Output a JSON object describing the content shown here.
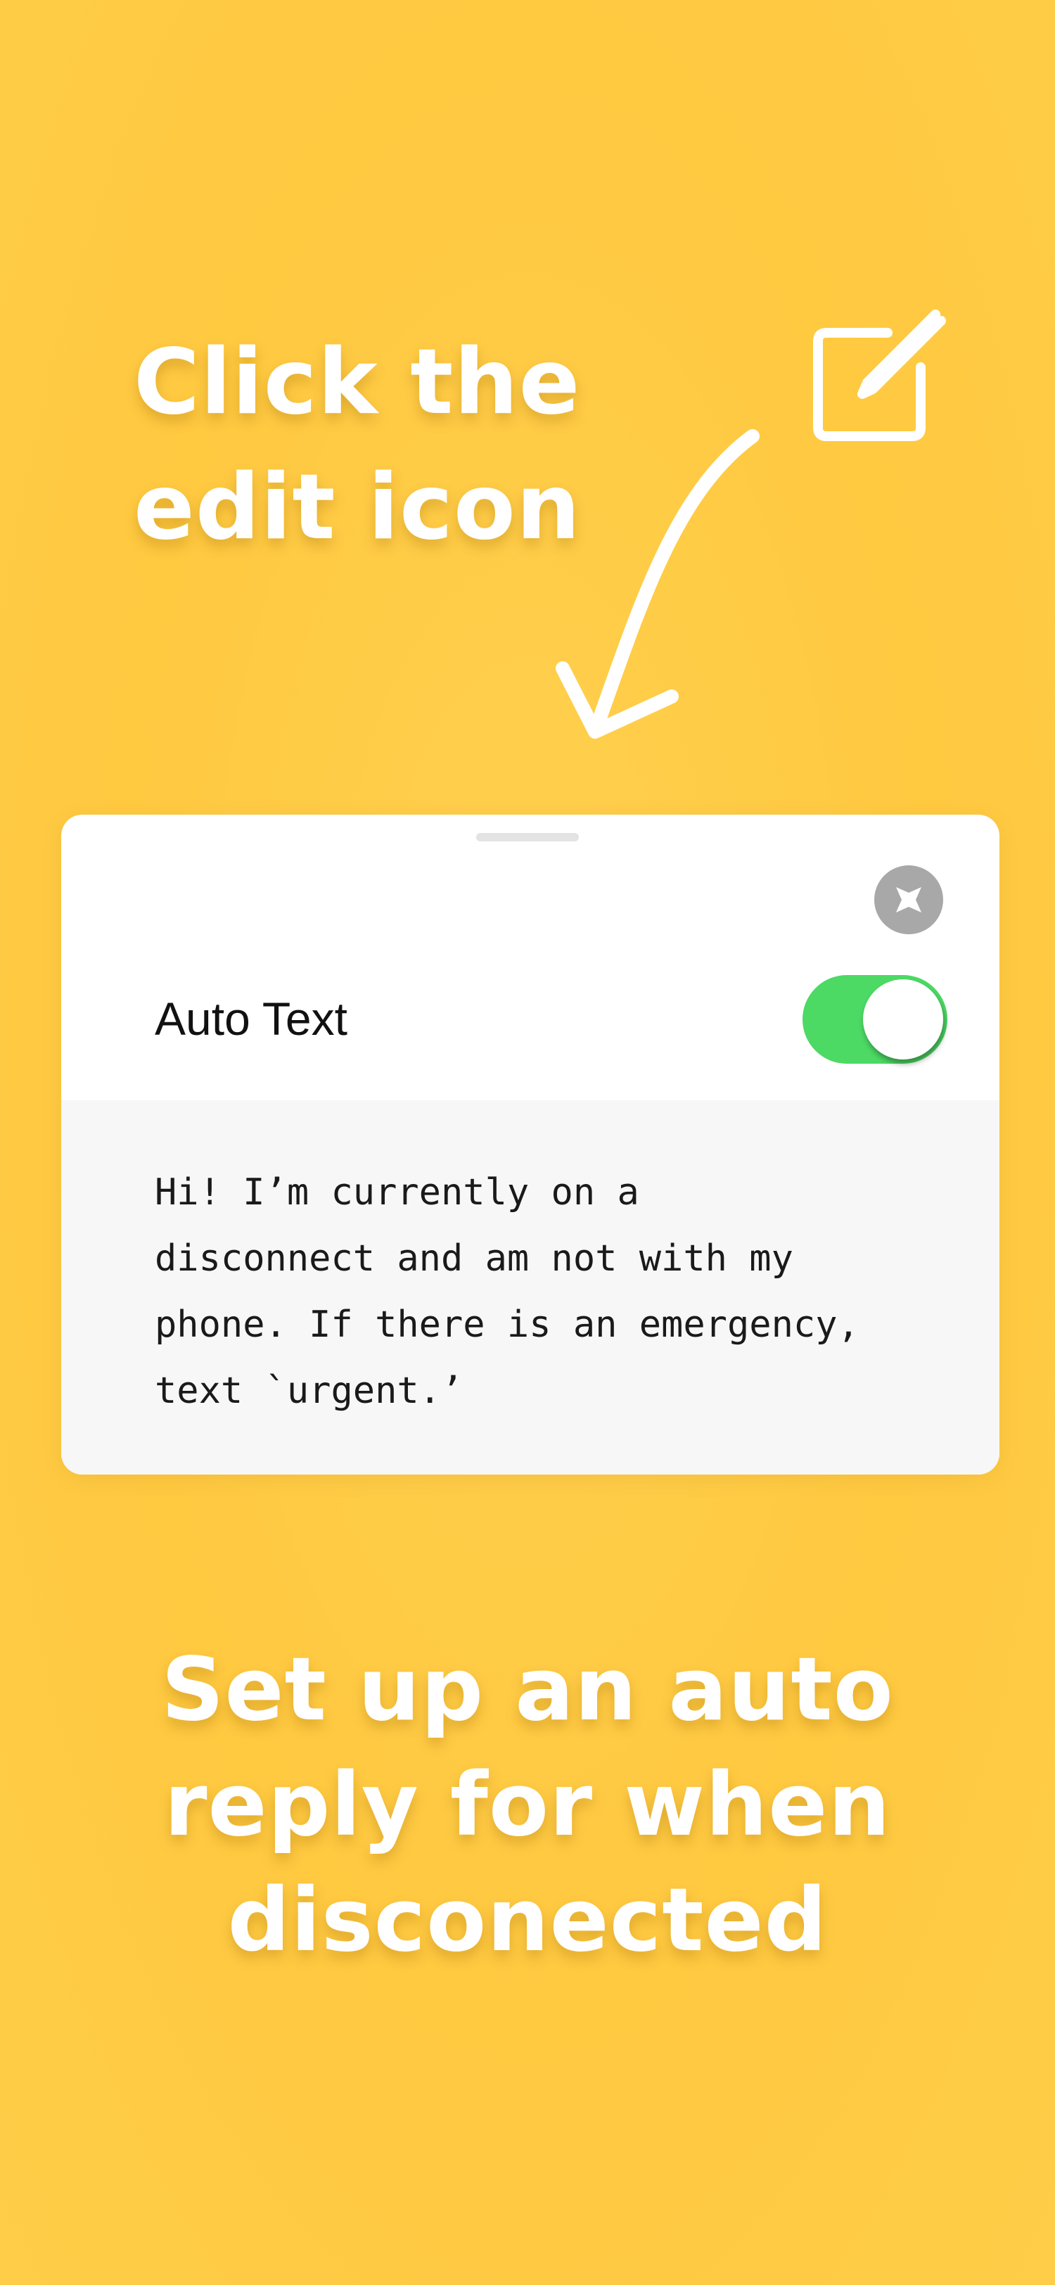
{
  "headline_top": {
    "line1": "Click the",
    "line2": "edit icon"
  },
  "icons": {
    "edit": "edit-icon",
    "arrow": "curved-arrow",
    "close": "close-icon"
  },
  "sheet": {
    "auto_text_label": "Auto Text",
    "auto_text_enabled": true,
    "message": "Hi! I’m currently on a\ndisconnect and am not with my\nphone. If there is an emergency,\ntext `urgent.’"
  },
  "headline_bottom": {
    "line1": "Set up an auto",
    "line2": "reply for when",
    "line3": "disconected"
  },
  "colors": {
    "background": "#ffc940",
    "toggle_on": "#4cd964",
    "close_button": "#a8a8a8",
    "message_background": "#f7f7f7"
  }
}
